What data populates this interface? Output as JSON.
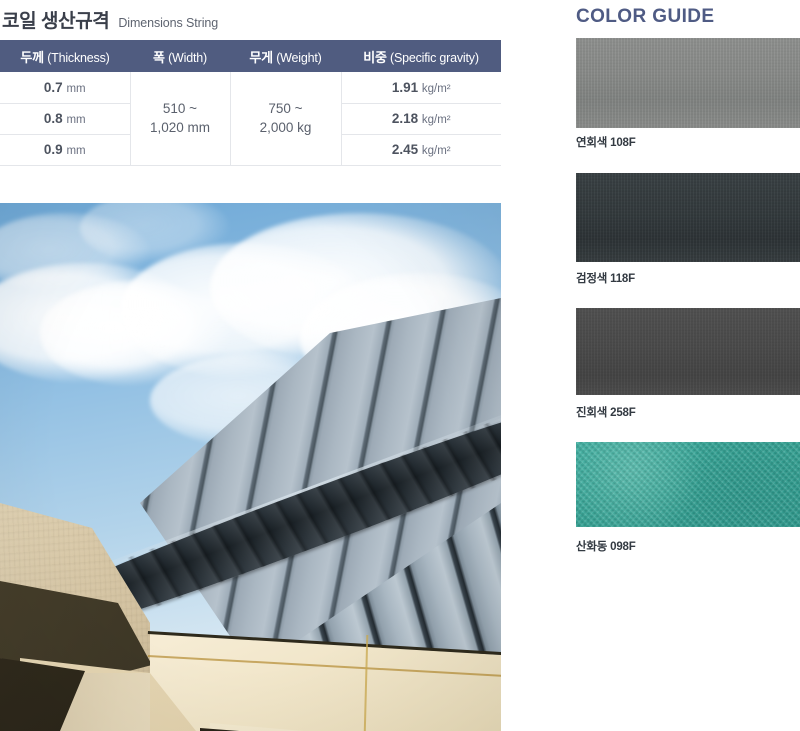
{
  "spec_section": {
    "title_ko": "코일 생산규격",
    "title_en": "Dimensions String",
    "header_accent_color": "#505C80",
    "columns": [
      {
        "ko": "두께",
        "en": "(Thickness)"
      },
      {
        "ko": "폭",
        "en": "(Width)"
      },
      {
        "ko": "무게",
        "en": "(Weight)"
      },
      {
        "ko": "비중",
        "en": "(Specific gravity)"
      }
    ],
    "thickness_values": [
      {
        "num": "0.7",
        "unit": "mm"
      },
      {
        "num": "0.8",
        "unit": "mm"
      },
      {
        "num": "0.9",
        "unit": "mm"
      }
    ],
    "width_value": {
      "line1": "510 ~",
      "line2": "1,020 mm"
    },
    "weight_value": {
      "line1": "750 ~",
      "line2": "2,000 kg"
    },
    "specific_gravity_values": [
      {
        "num": "1.91",
        "unit": "kg/m²"
      },
      {
        "num": "2.18",
        "unit": "kg/m²"
      },
      {
        "num": "2.45",
        "unit": "kg/m²"
      }
    ]
  },
  "photo": {
    "alt": "Curved standing-seam zinc metal roof over a concrete building against a blue sky with white clouds",
    "sky_color": "#8DBDE2",
    "roof_color": "#9DAAB6",
    "concrete_color": "#DFD0B0",
    "fascia_color": "#FBF5E2"
  },
  "color_guide": {
    "title": "COLOR GUIDE",
    "title_color": "#4F5B84",
    "swatches": [
      {
        "label": "연회색 108F",
        "hex": "#8A8C8A",
        "finish": "brushed"
      },
      {
        "label": "검정색 118F",
        "hex": "#353B3E",
        "finish": "brushed"
      },
      {
        "label": "진회색 258F",
        "hex": "#4B4B4B",
        "finish": "brushed"
      },
      {
        "label": "산화동 098F",
        "hex": "#36A899",
        "finish": "patina"
      }
    ]
  }
}
